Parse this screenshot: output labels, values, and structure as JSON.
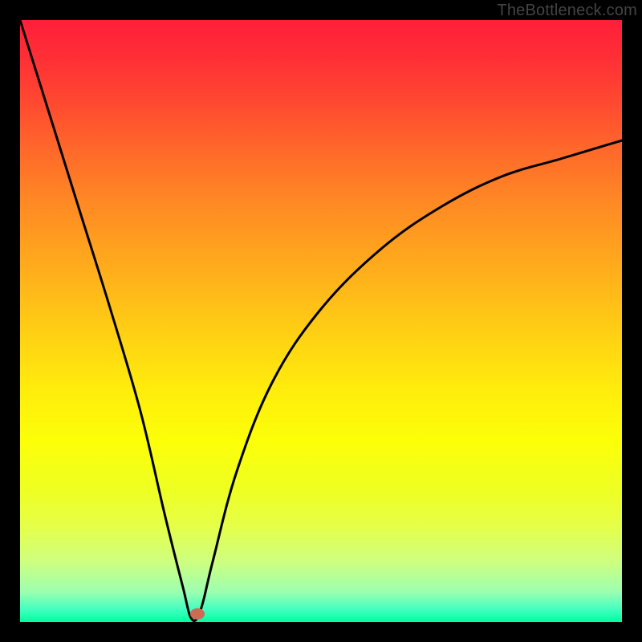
{
  "watermark": "TheBottleneck.com",
  "colors": {
    "frame": "#000000",
    "curve": "#000000",
    "marker": "#cf6a55",
    "gradient_top": "#ff1f3a",
    "gradient_bottom": "#00ff9f"
  },
  "chart_data": {
    "type": "line",
    "title": "",
    "xlabel": "",
    "ylabel": "",
    "xlim": [
      0,
      100
    ],
    "ylim": [
      0,
      100
    ],
    "grid": false,
    "legend": false,
    "annotations": [
      "TheBottleneck.com"
    ],
    "series": [
      {
        "name": "bottleneck-curve",
        "x": [
          0,
          5,
          10,
          15,
          20,
          24,
          27,
          28.5,
          30,
          32,
          36,
          42,
          50,
          60,
          70,
          80,
          90,
          100
        ],
        "y": [
          100,
          84,
          68,
          52,
          35,
          18,
          6,
          0.5,
          2,
          10,
          25,
          40,
          52,
          62,
          69,
          74,
          77,
          80
        ]
      }
    ],
    "markers": [
      {
        "name": "optimal-point",
        "x": 29.5,
        "y": 1.3
      }
    ],
    "background": {
      "type": "vertical-gradient",
      "description": "red (top, high bottleneck) to green (bottom, low bottleneck)"
    }
  }
}
